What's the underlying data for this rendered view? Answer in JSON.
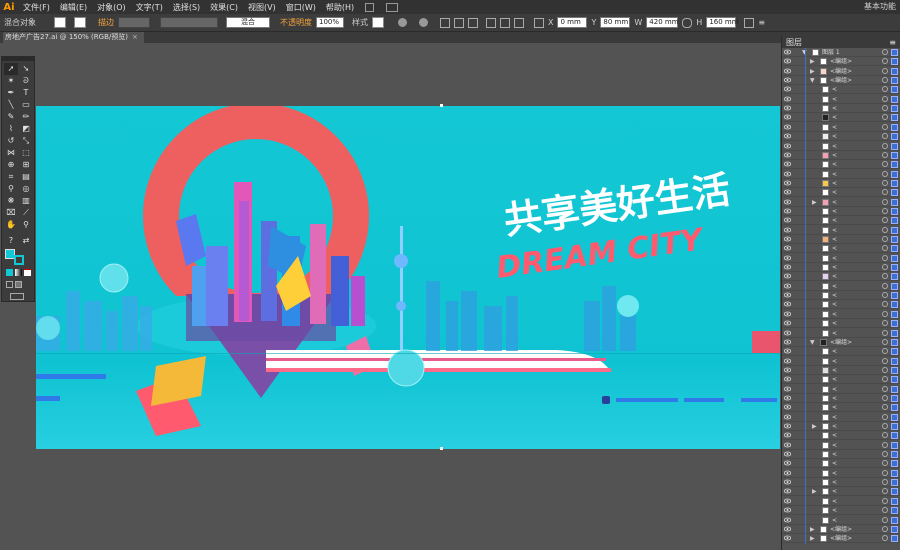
{
  "app": {
    "logo": "Ai",
    "workspace": "基本功能"
  },
  "menu": {
    "items": [
      "文件(F)",
      "编辑(E)",
      "对象(O)",
      "文字(T)",
      "选择(S)",
      "效果(C)",
      "视图(V)",
      "窗口(W)",
      "帮助(H)"
    ]
  },
  "control": {
    "mixed_objects": "混合对象",
    "stroke_label": "描边",
    "blend_mode": "混合",
    "opacity_label": "不透明度",
    "opacity_value": "100%",
    "style_label": "样式",
    "x_value": "0 mm",
    "y_value": "80 mm",
    "w_value": "420 mm",
    "h_value": "160 mm"
  },
  "document": {
    "tab_title": "房地产广告27.ai @ 150% (RGB/预览)",
    "close": "×"
  },
  "layers_panel": {
    "title": "图层",
    "top_layer": "图层 1",
    "group_label": "<编组>",
    "path_label": "<",
    "colors": {
      "selection": "#3b6fd1"
    }
  },
  "artwork": {
    "headline_cn": "共享美好生活",
    "headline_en": "DREAM CITY",
    "colors": {
      "background": "#14c7d4",
      "ring": "#ee5f5f",
      "pin": "#7a4fa8",
      "accent": "#ff5a6e"
    }
  }
}
